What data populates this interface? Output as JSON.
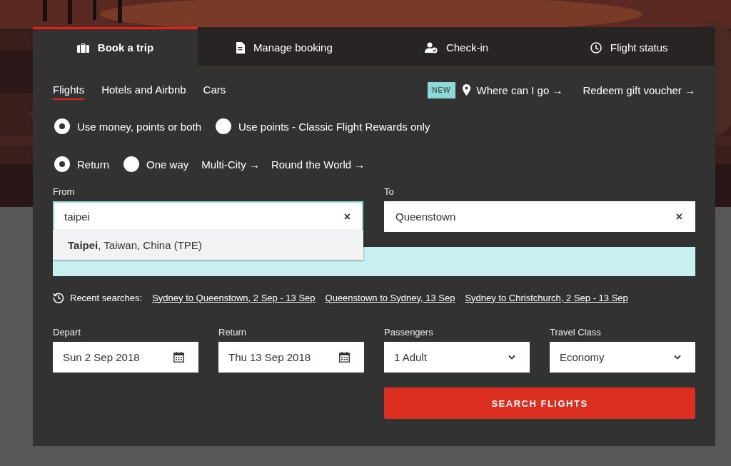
{
  "tabs": [
    {
      "label": "Book a trip",
      "kind": "suitcase",
      "selected": true
    },
    {
      "label": "Manage booking",
      "kind": "document",
      "selected": false
    },
    {
      "label": "Check-in",
      "kind": "person",
      "selected": false
    },
    {
      "label": "Flight status",
      "kind": "clock",
      "selected": false
    }
  ],
  "subtabs": [
    {
      "label": "Flights",
      "selected": true
    },
    {
      "label": "Hotels and Airbnb",
      "selected": false
    },
    {
      "label": "Cars",
      "selected": false
    }
  ],
  "links": {
    "badge": "NEW",
    "items": [
      {
        "label": "Where can I go →",
        "kind": "pin"
      },
      {
        "label": "Redeem gift voucher →",
        "kind": "plain"
      }
    ]
  },
  "payment_options": [
    {
      "label": "Use money, points or both",
      "selected": true
    },
    {
      "label": "Use points - Classic Flight Rewards only",
      "selected": false
    }
  ],
  "trip_types": [
    {
      "kind": "radio",
      "label": "Return",
      "selected": true
    },
    {
      "kind": "radio",
      "label": "One way",
      "selected": false
    },
    {
      "kind": "link",
      "label": "Multi-City →"
    },
    {
      "kind": "link",
      "label": "Round the World →"
    }
  ],
  "from": {
    "label": "From",
    "value": "taipei",
    "focused": true,
    "clear": "×"
  },
  "to": {
    "label": "To",
    "value": "Queenstown",
    "focused": false,
    "clear": "×"
  },
  "suggestions": [
    {
      "text": "**Taipei**, Taiwan, China (TPE)"
    }
  ],
  "recent": {
    "label": "Recent searches:",
    "items": [
      "Sydney to Queenstown, 2 Sep - 13 Sep",
      "Queenstown to Sydney, 13 Sep",
      "Sydney to Christchurch, 2 Sep - 13 Sep"
    ]
  },
  "fields": [
    {
      "label": "Depart",
      "value": "Sun 2 Sep 2018",
      "kind": "date"
    },
    {
      "label": "Return",
      "value": "Thu 13 Sep 2018",
      "kind": "date"
    },
    {
      "label": "Passengers",
      "value": "1 Adult",
      "kind": "select"
    },
    {
      "label": "Travel Class",
      "value": "Economy",
      "kind": "select"
    }
  ],
  "search_button": "SEARCH FLIGHTS"
}
